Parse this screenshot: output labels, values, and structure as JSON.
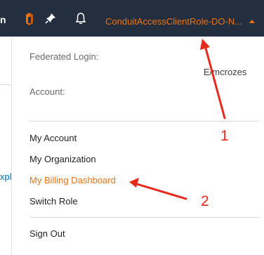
{
  "topbar": {
    "left_glyph": "n",
    "app_icon": "aws-service-icon",
    "pin_icon": "pin-icon",
    "bell_icon": "bell-icon",
    "role_label": "ConduitAccessClientRole-DO-N...",
    "caret_icon": "caret-up-icon",
    "accent_color": "#ec7211",
    "bg_color": "#232f3e"
  },
  "leftpane": {
    "fragment": "xplo"
  },
  "dropdown": {
    "federated_label": "Federated Login:",
    "federated_value": "E/mcrozes",
    "account_label": "Account:",
    "menu": [
      {
        "label": "My Account"
      },
      {
        "label": "My Organization"
      },
      {
        "label": "My Billing Dashboard"
      },
      {
        "label": "Switch Role"
      }
    ],
    "sign_out": "Sign Out"
  },
  "annotations": {
    "arrow_color": "#e8291c",
    "labels": [
      "1",
      "2"
    ]
  }
}
